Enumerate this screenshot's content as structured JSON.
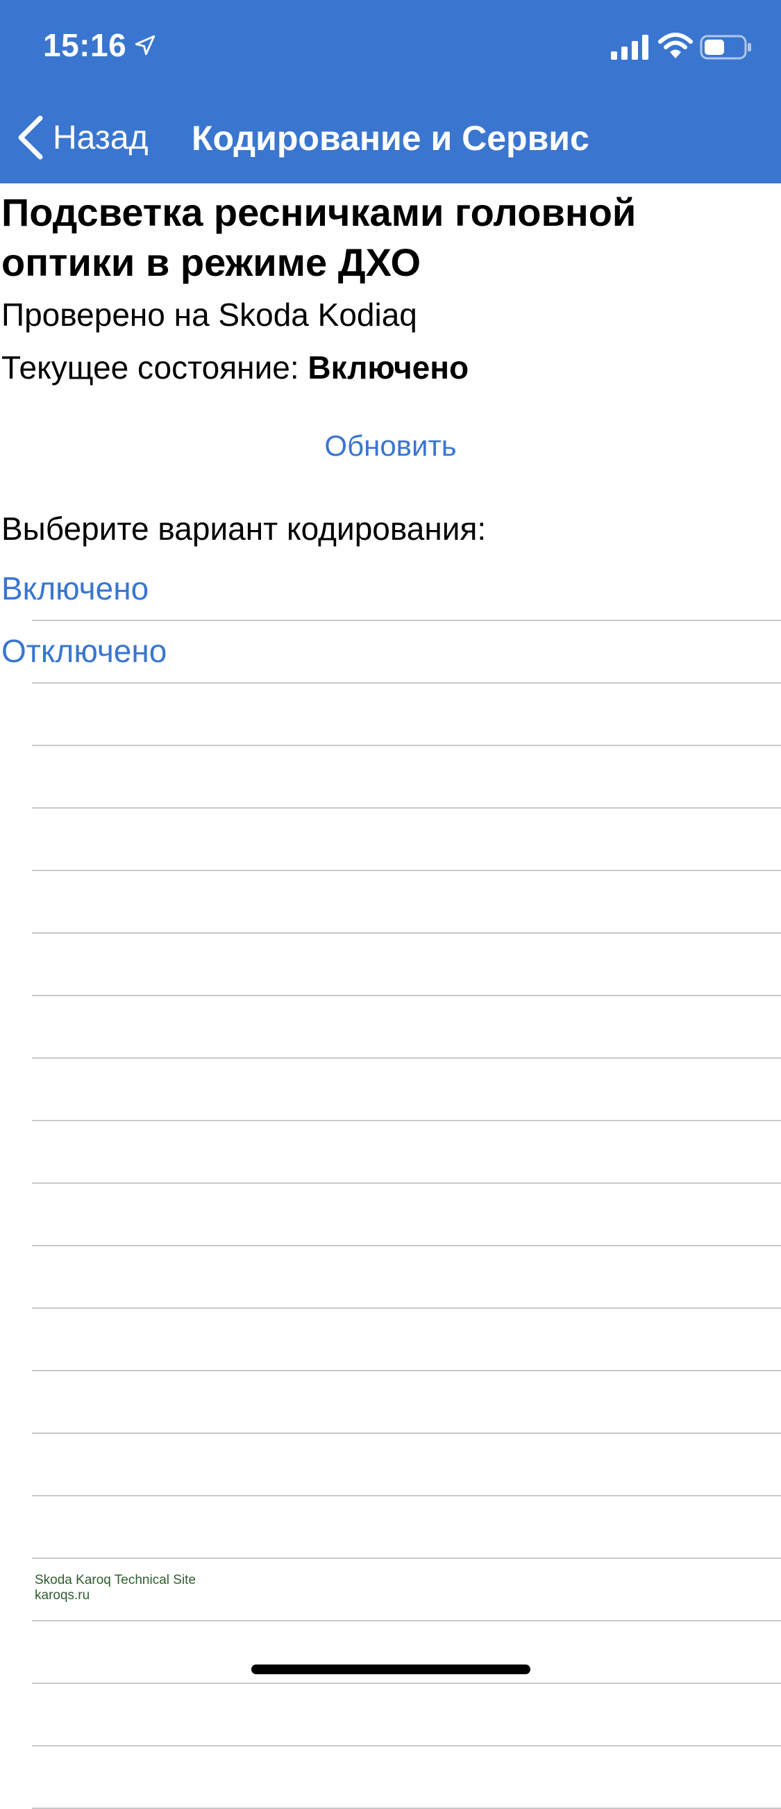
{
  "status_bar": {
    "time": "15:16"
  },
  "nav": {
    "back_label": "Назад",
    "title": "Кодирование и Сервис"
  },
  "content": {
    "heading": "Подсветка ресничками головной оптики в режиме ДХО",
    "tested_on": "Проверено на Skoda Kodiaq",
    "state_label": "Текущее состояние: ",
    "state_value": "Включено",
    "refresh_label": "Обновить",
    "choose_label": "Выберите вариант кодирования:",
    "options": [
      {
        "label": "Включено"
      },
      {
        "label": "Отключено"
      }
    ]
  },
  "watermark": {
    "line1": "Skoda Karoq Technical Site",
    "line2": "karoqs.ru"
  },
  "colors": {
    "accent": "#3a76d0",
    "nav_background": "#3a76d0",
    "separator": "#c8c8cc"
  }
}
